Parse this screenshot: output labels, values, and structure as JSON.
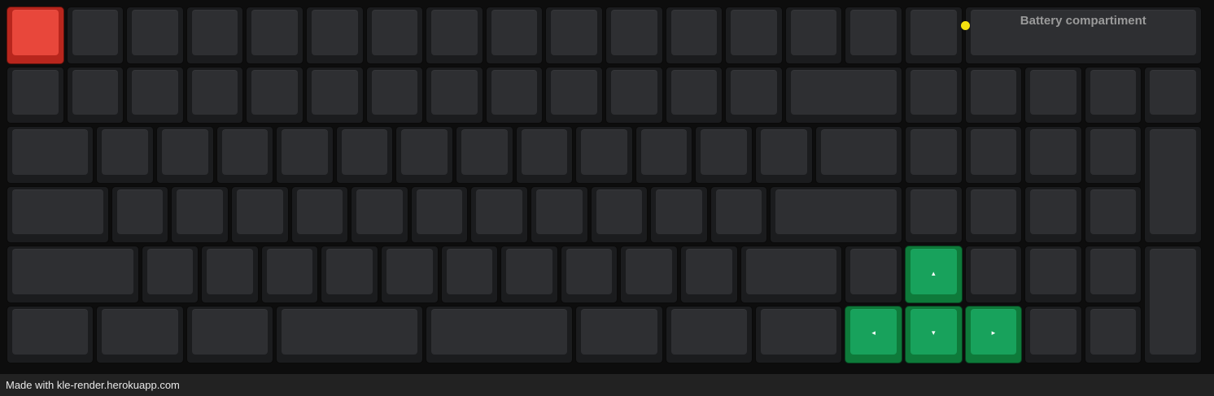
{
  "keyboard": {
    "caption": "Battery compartiment",
    "arrows": {
      "up": "▴",
      "left": "◂",
      "down": "▾",
      "right": "▸"
    },
    "colors": {
      "cap": "#2e2f32",
      "accent_green": "#18a25c",
      "accent_red": "#e8473b",
      "led": "#f4e10f"
    }
  },
  "footer": {
    "credit": "Made with kle-render.herokuapp.com"
  }
}
